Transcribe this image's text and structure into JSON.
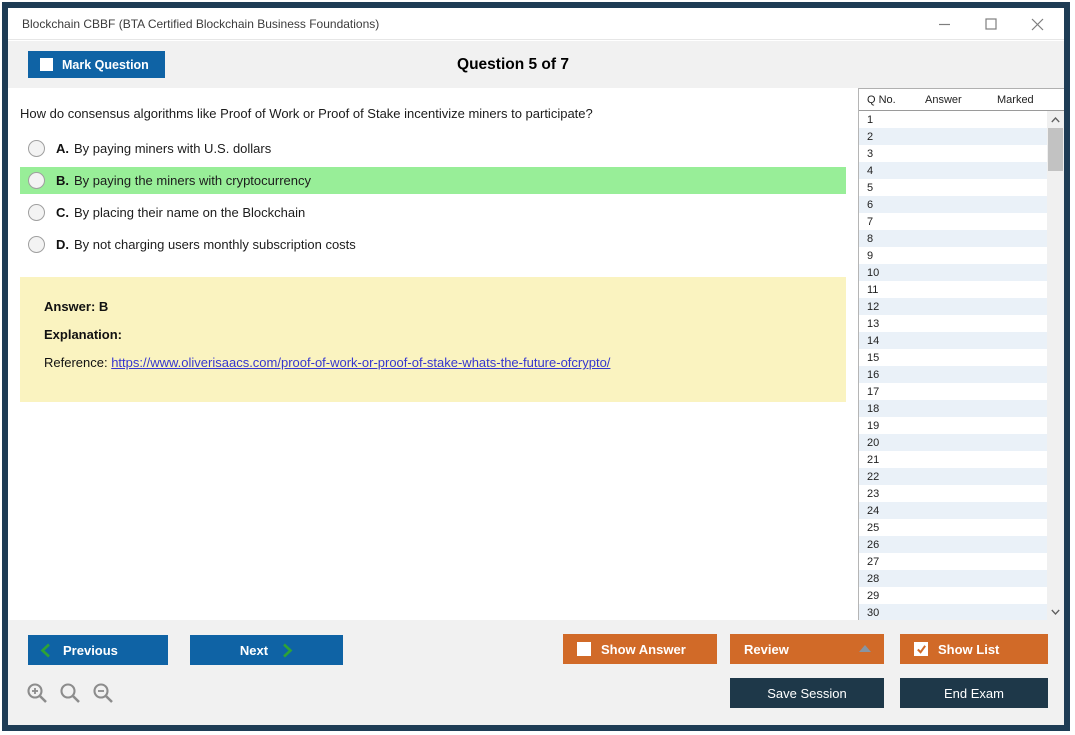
{
  "window": {
    "title": "Blockchain CBBF (BTA Certified Blockchain Business Foundations)"
  },
  "header": {
    "mark_question_label": "Mark Question",
    "question_counter": "Question 5 of 7"
  },
  "question": {
    "text": "How do consensus algorithms like Proof of Work or Proof of Stake incentivize miners to participate?",
    "options": [
      {
        "letter": "A.",
        "text": "By paying miners with U.S. dollars",
        "highlighted": false
      },
      {
        "letter": "B.",
        "text": "By paying the miners with cryptocurrency",
        "highlighted": true
      },
      {
        "letter": "C.",
        "text": "By placing their name on the Blockchain",
        "highlighted": false
      },
      {
        "letter": "D.",
        "text": "By not charging users monthly subscription costs",
        "highlighted": false
      }
    ]
  },
  "answer_panel": {
    "answer_text": "Answer: B",
    "explanation_label": "Explanation:",
    "reference_label": "Reference: ",
    "reference_url": "https://www.oliverisaacs.com/proof-of-work-or-proof-of-stake-whats-the-future-ofcrypto/"
  },
  "question_list": {
    "columns": [
      "Q No.",
      "Answer",
      "Marked"
    ],
    "rows": [
      {
        "q": "1",
        "answer": "",
        "marked": ""
      },
      {
        "q": "2",
        "answer": "",
        "marked": ""
      },
      {
        "q": "3",
        "answer": "",
        "marked": ""
      },
      {
        "q": "4",
        "answer": "",
        "marked": ""
      },
      {
        "q": "5",
        "answer": "",
        "marked": ""
      },
      {
        "q": "6",
        "answer": "",
        "marked": ""
      },
      {
        "q": "7",
        "answer": "",
        "marked": ""
      },
      {
        "q": "8",
        "answer": "",
        "marked": ""
      },
      {
        "q": "9",
        "answer": "",
        "marked": ""
      },
      {
        "q": "10",
        "answer": "",
        "marked": ""
      },
      {
        "q": "11",
        "answer": "",
        "marked": ""
      },
      {
        "q": "12",
        "answer": "",
        "marked": ""
      },
      {
        "q": "13",
        "answer": "",
        "marked": ""
      },
      {
        "q": "14",
        "answer": "",
        "marked": ""
      },
      {
        "q": "15",
        "answer": "",
        "marked": ""
      },
      {
        "q": "16",
        "answer": "",
        "marked": ""
      },
      {
        "q": "17",
        "answer": "",
        "marked": ""
      },
      {
        "q": "18",
        "answer": "",
        "marked": ""
      },
      {
        "q": "19",
        "answer": "",
        "marked": ""
      },
      {
        "q": "20",
        "answer": "",
        "marked": ""
      },
      {
        "q": "21",
        "answer": "",
        "marked": ""
      },
      {
        "q": "22",
        "answer": "",
        "marked": ""
      },
      {
        "q": "23",
        "answer": "",
        "marked": ""
      },
      {
        "q": "24",
        "answer": "",
        "marked": ""
      },
      {
        "q": "25",
        "answer": "",
        "marked": ""
      },
      {
        "q": "26",
        "answer": "",
        "marked": ""
      },
      {
        "q": "27",
        "answer": "",
        "marked": ""
      },
      {
        "q": "28",
        "answer": "",
        "marked": ""
      },
      {
        "q": "29",
        "answer": "",
        "marked": ""
      },
      {
        "q": "30",
        "answer": "",
        "marked": ""
      }
    ]
  },
  "footer": {
    "previous_label": "Previous",
    "next_label": "Next",
    "show_answer_label": "Show Answer",
    "show_answer_checked": false,
    "review_label": "Review",
    "show_list_label": "Show List",
    "show_list_checked": true,
    "save_session_label": "Save Session",
    "end_exam_label": "End Exam"
  },
  "icons": {
    "window_controls": [
      "minimize-icon",
      "maximize-icon",
      "close-icon"
    ],
    "previous_button": "chevron-left-icon",
    "next_button": "chevron-right-icon",
    "review_button": "triangle-up-icon",
    "scrollbar": [
      "chevron-up-icon",
      "chevron-down-icon"
    ],
    "zoom_toolbar": [
      "zoom-in-icon",
      "zoom-reset-icon",
      "zoom-out-icon"
    ]
  },
  "colors": {
    "frame_border": "#1e3c55",
    "primary_blue": "#0f63a5",
    "accent_orange": "#D16A28",
    "dark_navy": "#1e3849",
    "highlight_green": "#98EE98",
    "answer_box_yellow": "#FAF3C0",
    "alt_row_blue": "#EAF1F8",
    "link_blue": "#3636cf"
  }
}
